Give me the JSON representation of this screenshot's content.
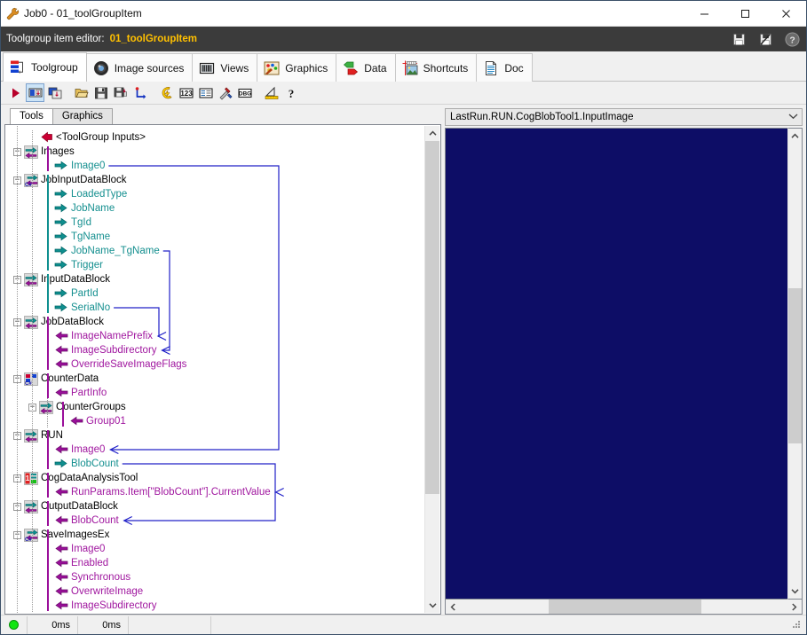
{
  "window": {
    "title": "Job0 - 01_toolGroupItem",
    "icon": "wrench-icon",
    "minimize": "–",
    "maximize": "☐",
    "close": "✕"
  },
  "header": {
    "label": "Toolgroup item editor:",
    "value": "01_toolGroupItem",
    "icons": [
      "save-icon",
      "save-as-icon",
      "help-icon"
    ]
  },
  "tabs": [
    {
      "label": "Toolgroup",
      "icon": "toolgroup-icon",
      "active": true
    },
    {
      "label": "Image sources",
      "icon": "camera-icon",
      "active": false
    },
    {
      "label": "Views",
      "icon": "views-icon",
      "active": false
    },
    {
      "label": "Graphics",
      "icon": "palette-icon",
      "active": false
    },
    {
      "label": "Data",
      "icon": "data-arrows-icon",
      "active": false
    },
    {
      "label": "Shortcuts",
      "icon": "shortcuts-icon",
      "active": false
    },
    {
      "label": "Doc",
      "icon": "document-icon",
      "active": false
    }
  ],
  "toolbar": [
    {
      "name": "run-icon",
      "title": "Run"
    },
    {
      "name": "add-tool-icon",
      "title": "Add tool",
      "selected": true
    },
    {
      "name": "add-toolgroup-icon",
      "title": "Add toolgroup"
    },
    {
      "name": "open-folder-icon",
      "title": "Open"
    },
    {
      "name": "save-icon",
      "title": "Save"
    },
    {
      "name": "save-as-icon",
      "title": "Save as"
    },
    {
      "name": "undo-arrow-icon",
      "title": "Restore"
    },
    {
      "name": "lightning-icon",
      "title": "Run once"
    },
    {
      "name": "numbers-icon",
      "title": "Values"
    },
    {
      "name": "properties-icon",
      "title": "Properties"
    },
    {
      "name": "tools-icon",
      "title": "Tools"
    },
    {
      "name": "debug-icon",
      "title": "Debug"
    },
    {
      "name": "measure-icon",
      "title": "Measure"
    },
    {
      "name": "help-icon",
      "title": "Help"
    }
  ],
  "left_panel": {
    "subtabs": [
      {
        "label": "Tools",
        "active": true
      },
      {
        "label": "Graphics",
        "active": false
      }
    ],
    "tree": [
      {
        "label": "<ToolGroup Inputs>",
        "depth": 1,
        "icon": "terminal-left-red",
        "color": "dark",
        "expander": null
      },
      {
        "label": "Images",
        "depth": 0,
        "icon": "toolgroup-io",
        "color": "dark",
        "expander": "minus"
      },
      {
        "label": "Image0",
        "depth": 2,
        "icon": "arrow-right-teal",
        "color": "teal",
        "expander": null
      },
      {
        "label": "JobInputDataBlock",
        "depth": 0,
        "icon": "datablock-cs",
        "color": "dark",
        "expander": "minus"
      },
      {
        "label": "LoadedType",
        "depth": 2,
        "icon": "arrow-right-teal",
        "color": "teal",
        "expander": null
      },
      {
        "label": "JobName",
        "depth": 2,
        "icon": "arrow-right-teal",
        "color": "teal",
        "expander": null
      },
      {
        "label": "TgId",
        "depth": 2,
        "icon": "arrow-right-teal",
        "color": "teal",
        "expander": null
      },
      {
        "label": "TgName",
        "depth": 2,
        "icon": "arrow-right-teal",
        "color": "teal",
        "expander": null
      },
      {
        "label": "JobName_TgName",
        "depth": 2,
        "icon": "arrow-right-teal",
        "color": "teal",
        "expander": null
      },
      {
        "label": "Trigger",
        "depth": 2,
        "icon": "arrow-right-teal",
        "color": "teal",
        "expander": null
      },
      {
        "label": "InputDataBlock",
        "depth": 0,
        "icon": "toolgroup-io",
        "color": "dark",
        "expander": "minus"
      },
      {
        "label": "PartId",
        "depth": 2,
        "icon": "arrow-right-teal",
        "color": "teal",
        "expander": null
      },
      {
        "label": "SerialNo",
        "depth": 2,
        "icon": "arrow-right-teal",
        "color": "teal",
        "expander": null
      },
      {
        "label": "JobDataBlock",
        "depth": 0,
        "icon": "toolgroup-io",
        "color": "dark",
        "expander": "minus"
      },
      {
        "label": "ImageNamePrefix",
        "depth": 2,
        "icon": "arrow-left-purple",
        "color": "purple",
        "expander": null
      },
      {
        "label": "ImageSubdirectory",
        "depth": 2,
        "icon": "arrow-left-purple",
        "color": "purple",
        "expander": null
      },
      {
        "label": "OverrideSaveImageFlags",
        "depth": 2,
        "icon": "arrow-left-purple",
        "color": "purple",
        "expander": null
      },
      {
        "label": "CounterData",
        "depth": 0,
        "icon": "counterdata-cs",
        "color": "dark",
        "expander": "minus"
      },
      {
        "label": "PartInfo",
        "depth": 2,
        "icon": "arrow-left-purple",
        "color": "purple",
        "expander": null
      },
      {
        "label": "CounterGroups",
        "depth": 1,
        "icon": "toolgroup-io",
        "color": "dark",
        "expander": "minus"
      },
      {
        "label": "Group01",
        "depth": 3,
        "icon": "arrow-left-purple",
        "color": "purple",
        "expander": null
      },
      {
        "label": "RUN",
        "depth": 0,
        "icon": "toolgroup-io",
        "color": "dark",
        "expander": "minus"
      },
      {
        "label": "Image0",
        "depth": 2,
        "icon": "arrow-left-purple",
        "color": "purple",
        "expander": null
      },
      {
        "label": "BlobCount",
        "depth": 2,
        "icon": "arrow-right-teal",
        "color": "teal",
        "expander": null
      },
      {
        "label": "CogDataAnalysisTool",
        "depth": 0,
        "icon": "analysis-tool",
        "color": "dark",
        "expander": "minus"
      },
      {
        "label": "RunParams.Item[\"BlobCount\"].CurrentValue",
        "depth": 2,
        "icon": "arrow-left-purple",
        "color": "purple",
        "expander": null
      },
      {
        "label": "OutputDataBlock",
        "depth": 0,
        "icon": "toolgroup-io",
        "color": "dark",
        "expander": "minus"
      },
      {
        "label": "BlobCount",
        "depth": 2,
        "icon": "arrow-left-purple",
        "color": "purple",
        "expander": null
      },
      {
        "label": "SaveImagesEx",
        "depth": 0,
        "icon": "datablock-cs",
        "color": "dark",
        "expander": "minus"
      },
      {
        "label": "Image0",
        "depth": 2,
        "icon": "arrow-left-purple",
        "color": "purple",
        "expander": null
      },
      {
        "label": "Enabled",
        "depth": 2,
        "icon": "arrow-left-purple",
        "color": "purple",
        "expander": null
      },
      {
        "label": "Synchronous",
        "depth": 2,
        "icon": "arrow-left-purple",
        "color": "purple",
        "expander": null
      },
      {
        "label": "OverwriteImage",
        "depth": 2,
        "icon": "arrow-left-purple",
        "color": "purple",
        "expander": null
      },
      {
        "label": "ImageSubdirectory",
        "depth": 2,
        "icon": "arrow-left-purple",
        "color": "purple",
        "expander": null
      }
    ],
    "link_color": "#2020c8"
  },
  "right_panel": {
    "source": "LastRun.RUN.CogBlobTool1.InputImage",
    "image_background": "#0d0d66",
    "dropdown_icon": "chevron-down-icon",
    "scroll_left_icon": "‹",
    "scroll_right_icon": "›",
    "scroll_up_icon": "⌃",
    "scroll_down_icon": "⌄"
  },
  "statusbar": {
    "led": "green-status-led",
    "time1": "0ms",
    "time2": "0ms",
    "extra": "",
    "grip": "resize-grip"
  }
}
